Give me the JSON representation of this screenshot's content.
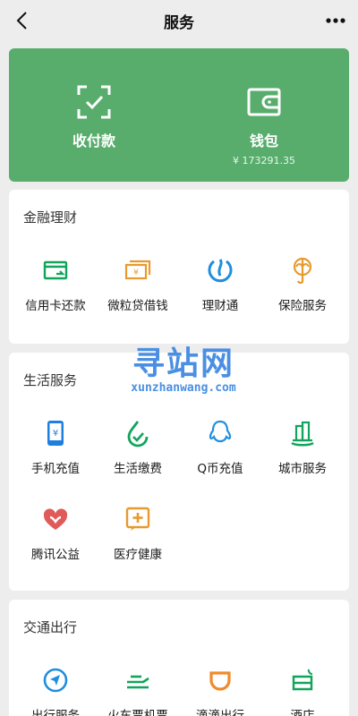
{
  "nav": {
    "title": "服务"
  },
  "hero": {
    "pay_label": "收付款",
    "wallet_label": "钱包",
    "wallet_balance": "¥ 173291.35",
    "accent": "#58ad6d"
  },
  "finance": {
    "title": "金融理财",
    "items": [
      {
        "label": "信用卡还款",
        "icon": "credit-card-icon"
      },
      {
        "label": "微粒贷借钱",
        "icon": "loan-icon"
      },
      {
        "label": "理财通",
        "icon": "wealth-icon"
      },
      {
        "label": "保险服务",
        "icon": "insurance-icon"
      }
    ]
  },
  "life": {
    "title": "生活服务",
    "items": [
      {
        "label": "手机充值",
        "icon": "phone-topup-icon"
      },
      {
        "label": "生活缴费",
        "icon": "utility-bill-icon"
      },
      {
        "label": "Q币充值",
        "icon": "qq-coin-icon"
      },
      {
        "label": "城市服务",
        "icon": "city-service-icon"
      },
      {
        "label": "腾讯公益",
        "icon": "charity-icon"
      },
      {
        "label": "医疗健康",
        "icon": "medical-icon"
      }
    ]
  },
  "travel": {
    "title": "交通出行",
    "items": [
      {
        "label": "出行服务",
        "icon": "travel-service-icon"
      },
      {
        "label": "火车票机票",
        "icon": "train-ticket-icon"
      },
      {
        "label": "滴滴出行",
        "icon": "didi-icon"
      },
      {
        "label": "酒店",
        "icon": "hotel-icon"
      }
    ]
  },
  "watermark": {
    "text": "寻站网",
    "domain": "xunzhanwang.com"
  }
}
